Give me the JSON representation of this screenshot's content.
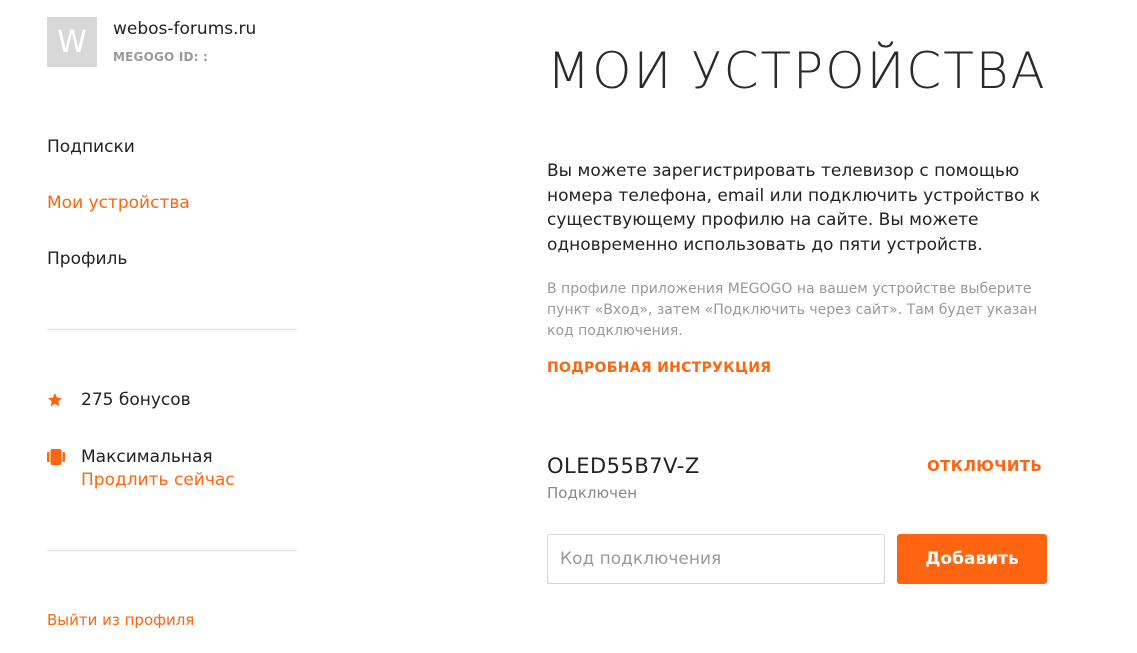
{
  "sidebar": {
    "avatar_letter": "W",
    "username": "webos-forums.ru",
    "megogo_id_label": "MEGOGO ID: :",
    "nav": {
      "subscriptions": "Подписки",
      "my_devices": "Мои устройства",
      "profile": "Профиль"
    },
    "bonuses": "275 бонусов",
    "subscription_name": "Максимальная",
    "extend_link": "Продлить сейчас",
    "logout": "Выйти из профиля"
  },
  "main": {
    "title": "МОИ УСТРОЙСТВА",
    "intro": "Вы можете зарегистрировать телевизор с помощью номера телефона, email или подключить устройство к существующему профилю на сайте. Вы можете одновременно использовать до пяти устройств.",
    "hint": "В профиле приложения MEGOGO на вашем устройстве выберите пункт «Вход», затем «Подключить через сайт». Там будет указан код подключения.",
    "instruction_link": "ПОДРОБНАЯ ИНСТРУКЦИЯ",
    "device": {
      "name": "OLED55B7V-Z",
      "status": "Подключен",
      "disconnect_label": "ОТКЛЮЧИТЬ"
    },
    "code_input": {
      "value": "",
      "placeholder": "Код подключения"
    },
    "add_button_label": "Добавить"
  },
  "colors": {
    "accent": "#ff6410",
    "muted_text": "#999999",
    "divider": "#dcdcdc",
    "avatar_bg": "#d8d8d8"
  },
  "icons": {
    "bonus": "star-icon",
    "subscription": "subscription-badge-icon"
  }
}
